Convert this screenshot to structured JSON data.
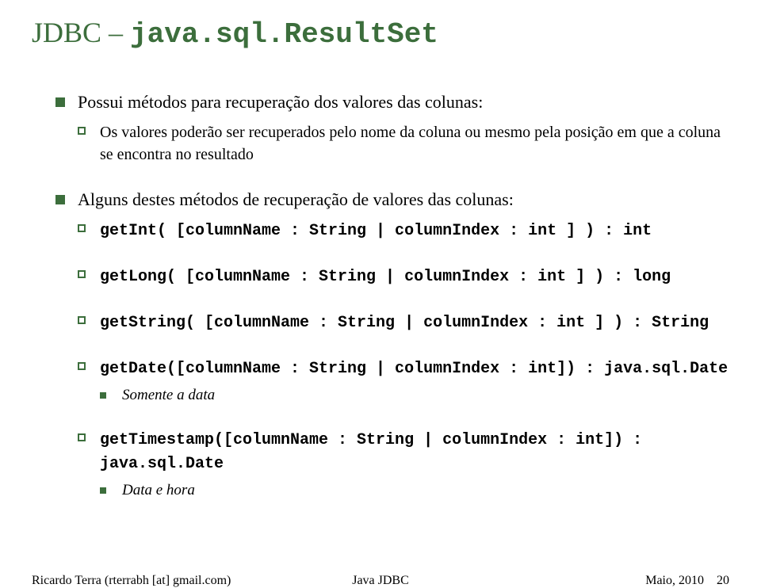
{
  "title": {
    "prefix": "JDBC – ",
    "code": "java.sql.ResultSet"
  },
  "bullet1": {
    "text": "Possui métodos para recuperação dos valores das colunas:",
    "sub": "Os valores poderão ser recuperados pelo nome da coluna ou mesmo pela posição em que a coluna se encontra no resultado"
  },
  "bullet2": {
    "text": "Alguns destes métodos de recuperação de valores das colunas:",
    "m1": "getInt( [columnName : String | columnIndex : int ] ) : int",
    "m2": "getLong( [columnName : String | columnIndex : int ] ) : long",
    "m3": "getString( [columnName : String | columnIndex : int ] ) : String",
    "m4": "getDate([columnName : String | columnIndex : int]) : java.sql.Date",
    "m4_sub": "Somente a data",
    "m5": "getTimestamp([columnName : String | columnIndex : int]) : java.sql.Date",
    "m5_sub": "Data e hora"
  },
  "footer": {
    "left": "Ricardo Terra (rterrabh [at] gmail.com)",
    "center": "Java JDBC",
    "right_date": "Maio, 2010",
    "right_page": "20"
  }
}
